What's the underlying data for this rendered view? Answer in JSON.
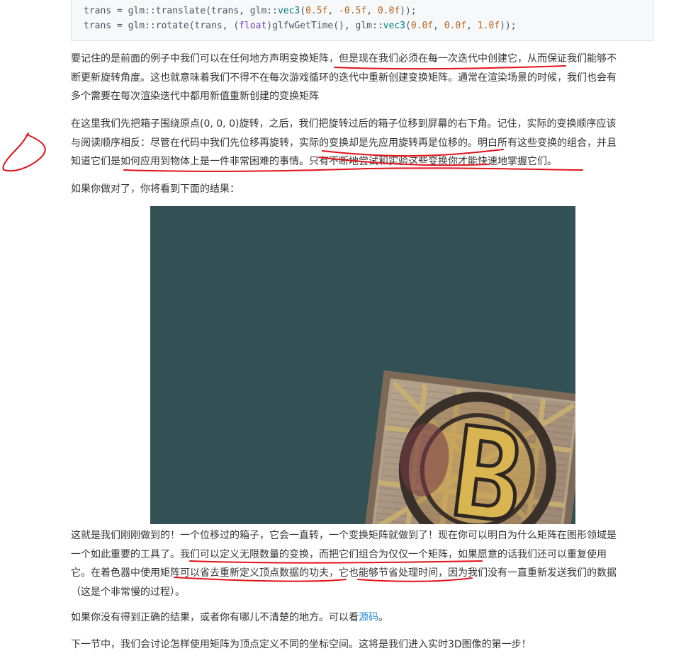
{
  "code": {
    "line1": {
      "pre": "trans = glm::translate(trans, glm::",
      "type": "vec3",
      "open": "(",
      "n1": "0.5f",
      "sep1": ", ",
      "n2": "-0.5f",
      "sep2": ", ",
      "n3": "0.0f",
      "close": "));"
    },
    "line2": {
      "pre": "trans = glm::rotate(trans, (",
      "kw": "float",
      "mid": ")glfwGetTime(), glm::",
      "type": "vec3",
      "open": "(",
      "n1": "0.0f",
      "sep1": ", ",
      "n2": "0.0f",
      "sep2": ", ",
      "n3": "1.0f",
      "close": "));"
    }
  },
  "paragraphs": {
    "p1": [
      "要记住的是前面的例子中我们可以在任何地方声明变换矩阵，但是现在我们必须在每一次迭代中创建它，从而保证我们能够不",
      "断更新旋转角度。这也就意味着我们不得不在每次游戏循环的迭代中重新创建变换矩阵。通常在渲染场景的时候，我们也会有",
      "多个需要在每次渲染迭代中都用新值重新创建的变换矩阵"
    ],
    "p2": [
      "在这里我们先把箱子围绕原点(0, 0, 0)旋转，之后，我们把旋转过后的箱子位移到屏幕的右下角。记住，实际的变换顺序应该",
      "与阅读顺序相反：尽管在代码中我们先位移再旋转，实际的变换却是先应用旋转再是位移的。明白所有这些变换的组合，并且",
      "知道它们是如何应用到物体上是一件非常困难的事情。只有不断地尝试和实验这些变换你才能快速地掌握它们。"
    ],
    "p3": "如果你做对了，你将看到下面的结果：",
    "p4": [
      "这就是我们刚刚做到的！一个位移过的箱子，它会一直转，一个变换矩阵就做到了！现在你可以明白为什么矩阵在图形领域是",
      "一个如此重要的工具了。我们可以定义无限数量的变换，而把它们组合为仅仅一个矩阵，如果愿意的话我们还可以重复使用",
      "它。在着色器中使用矩阵可以省去重新定义顶点数据的功夫，它也能够节省处理时间，因为我们没有一直重新发送我们的数据",
      "（这是个非常慢的过程）。"
    ],
    "p5": {
      "before": "如果你没有得到正确的结果，或者你有哪儿不清楚的地方。可以看",
      "link": "源码",
      "after": "。"
    },
    "p6": "下一节中，我们会讨论怎样使用矩阵为顶点定义不同的坐标空间。这将是我们进入实时3D图像的第一步！"
  },
  "colors": {
    "render_background": "#335155",
    "annotation_ink": "#e0121a",
    "link": "#2f8dd8"
  }
}
